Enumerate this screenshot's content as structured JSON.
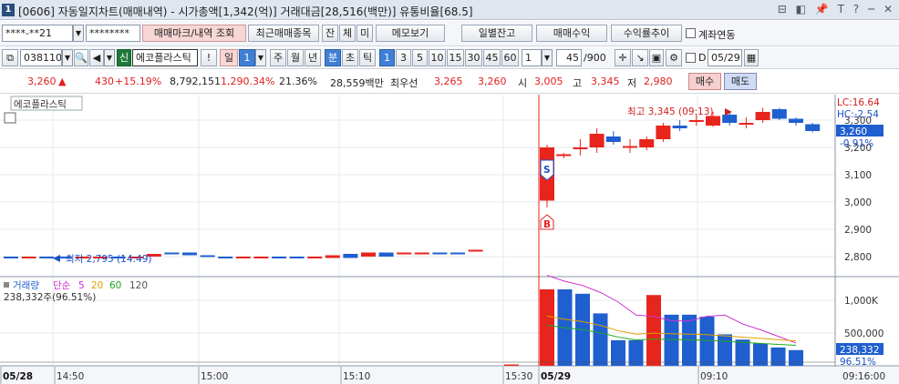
{
  "window": {
    "number": "1",
    "title": "[0606] 자동일지차트(매매내역) - 시가총액[1,342(억)] 거래대금[28,516(백만)] 유통비율[68.5]",
    "tools": "⊟ ◧ 📌 T ?  ─ ✕"
  },
  "toolbar": {
    "account_masked": "****-**21",
    "password_masked": "********",
    "trade_mark_button": "매매마크/내역 조회",
    "recent_trade_button": "최근매매종목",
    "btn_jan": "잔",
    "btn_che": "체",
    "btn_mi": "미",
    "memo_button": "메모보기",
    "daily_balance_button": "일별잔고",
    "trade_profit_button": "매매수익",
    "yield_trend_button": "수익률추이",
    "account_link_label": "계좌연동"
  },
  "toolbar2": {
    "code": "038110",
    "shin": "신",
    "stock_name": "에코플라스틱",
    "alert": "!",
    "period_il": "일",
    "period_value": "1",
    "period_ju": "주",
    "period_wol": "월",
    "period_nyeon": "년",
    "period_bun": "분",
    "period_cho": "초",
    "period_tik": "틱",
    "minute_options": [
      "1",
      "3",
      "5",
      "10",
      "15",
      "30",
      "45",
      "60"
    ],
    "minute_selected": "1",
    "interval_value": "1",
    "count_value": "45",
    "count_max": "/900",
    "date_label": "D",
    "date_value": "05/29"
  },
  "quote": {
    "price": "3,260",
    "change_arrow": "▲",
    "change": "430",
    "change_pct": "+15.19%",
    "volume": "8,792,151",
    "volume_ratio": "1,290.34%",
    "turnover": "21.36%",
    "amount": "28,559백만",
    "best_label": "최우선",
    "ask": "3,265",
    "bid": "3,260",
    "open_label": "시",
    "open": "3,005",
    "high_label": "고",
    "high": "3,345",
    "low_label": "저",
    "low": "2,980",
    "buy_button": "매수",
    "sell_button": "매도"
  },
  "chart_data": {
    "type": "candlestick",
    "stock_label": "에코플라스틱",
    "price_axis": {
      "ticks": [
        "3,300",
        "3,200",
        "3,100",
        "3,000",
        "2,900",
        "2,800"
      ],
      "lc_label": "LC:16.64",
      "hc_label": "HC:-2.54",
      "current_price": "3,260",
      "current_pct": "-0.91%"
    },
    "annotations": {
      "high_note": "최고 3,345 (09:13)",
      "low_note": "최저 2,795 (14:49)",
      "sell_marker": "S",
      "buy_marker": "B"
    },
    "candles_day1": [
      {
        "o": 2800,
        "c": 2800
      },
      {
        "o": 2800,
        "c": 2800
      },
      {
        "o": 2800,
        "c": 2795
      },
      {
        "o": 2800,
        "c": 2800
      },
      {
        "o": 2800,
        "c": 2800
      },
      {
        "o": 2800,
        "c": 2800
      },
      {
        "o": 2800,
        "c": 2800
      },
      {
        "o": 2800,
        "c": 2800
      },
      {
        "o": 2800,
        "c": 2810
      },
      {
        "o": 2815,
        "c": 2815
      },
      {
        "o": 2815,
        "c": 2805
      },
      {
        "o": 2805,
        "c": 2800
      },
      {
        "o": 2800,
        "c": 2795
      },
      {
        "o": 2800,
        "c": 2800
      },
      {
        "o": 2800,
        "c": 2800
      },
      {
        "o": 2800,
        "c": 2800
      },
      {
        "o": 2800,
        "c": 2795
      },
      {
        "o": 2800,
        "c": 2800
      },
      {
        "o": 2795,
        "c": 2805
      },
      {
        "o": 2810,
        "c": 2795
      },
      {
        "o": 2800,
        "c": 2815
      },
      {
        "o": 2815,
        "c": 2800
      },
      {
        "o": 2810,
        "c": 2815
      },
      {
        "o": 2810,
        "c": 2815
      },
      {
        "o": 2815,
        "c": 2815
      },
      {
        "o": 2815,
        "c": 2810
      },
      {
        "o": 2825,
        "c": 2825
      }
    ],
    "candles_day2": [
      {
        "o": 3005,
        "c": 3200,
        "h": 3210,
        "l": 2980
      },
      {
        "o": 3170,
        "c": 3175,
        "h": 3180,
        "l": 3160
      },
      {
        "o": 3200,
        "c": 3200,
        "h": 3230,
        "l": 3170
      },
      {
        "o": 3200,
        "c": 3250,
        "h": 3270,
        "l": 3180
      },
      {
        "o": 3240,
        "c": 3220,
        "h": 3260,
        "l": 3210
      },
      {
        "o": 3200,
        "c": 3205,
        "h": 3230,
        "l": 3180
      },
      {
        "o": 3200,
        "c": 3230,
        "h": 3240,
        "l": 3190
      },
      {
        "o": 3230,
        "c": 3280,
        "h": 3290,
        "l": 3220
      },
      {
        "o": 3280,
        "c": 3270,
        "h": 3300,
        "l": 3260
      },
      {
        "o": 3300,
        "c": 3300,
        "h": 3320,
        "l": 3280
      },
      {
        "o": 3280,
        "c": 3315,
        "h": 3330,
        "l": 3275
      },
      {
        "o": 3320,
        "c": 3290,
        "h": 3330,
        "l": 3280
      },
      {
        "o": 3290,
        "c": 3290,
        "h": 3310,
        "l": 3270
      },
      {
        "o": 3300,
        "c": 3330,
        "h": 3345,
        "l": 3290
      },
      {
        "o": 3340,
        "c": 3305,
        "h": 3345,
        "l": 3300
      },
      {
        "o": 3305,
        "c": 3290,
        "h": 3310,
        "l": 3280
      },
      {
        "o": 3285,
        "c": 3260,
        "h": 3290,
        "l": 3255
      }
    ],
    "volume_panel": {
      "title": "거래량",
      "ma_label": "단순",
      "ma_periods": [
        "5",
        "20",
        "60",
        "120"
      ],
      "volume_text": "238,332주(96.51%)",
      "ticks": [
        "1,000K",
        "500,000"
      ],
      "current": "238,332",
      "current_pct": "96.51%",
      "bars_day2": [
        1380,
        1200,
        1100,
        800,
        390,
        390,
        1080,
        780,
        780,
        750,
        480,
        400,
        340,
        280,
        240
      ]
    },
    "time_axis": {
      "labels": [
        "05/28",
        "14:50",
        "15:00",
        "15:10",
        "15:30",
        "05/29",
        "09:10",
        "09:16:00"
      ]
    },
    "colors": {
      "up": "#e8251d",
      "down": "#1f5fcf",
      "ma5": "#d030d0",
      "ma20": "#e0a000",
      "ma60": "#1fa81f",
      "ma120": "#555555"
    }
  }
}
